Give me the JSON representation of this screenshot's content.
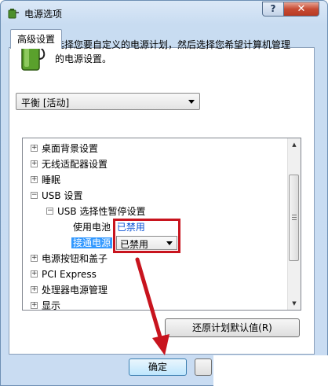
{
  "window": {
    "title": "电源选项",
    "help_label": "?",
    "close_label": "✕"
  },
  "tabs": [
    {
      "label": "高级设置"
    }
  ],
  "description": "选择您要自定义的电源计划，然后选择您希望计算机管理的电源设置。",
  "plan_select": {
    "value": "平衡 [活动]"
  },
  "tree": {
    "items": [
      {
        "label": "桌面背景设置",
        "expander": "+"
      },
      {
        "label": "无线适配器设置",
        "expander": "+"
      },
      {
        "label": "睡眠",
        "expander": "+"
      },
      {
        "label": "USB 设置",
        "expander": "−"
      },
      {
        "label": "USB 选择性暂停设置",
        "expander": "−"
      },
      {
        "label": "使用电池",
        "value": "已禁用"
      },
      {
        "label": "接通电源",
        "value": "已禁用"
      },
      {
        "label": "电源按钮和盖子",
        "expander": "+"
      },
      {
        "label": "PCI Express",
        "expander": "+"
      },
      {
        "label": "处理器电源管理",
        "expander": "+"
      },
      {
        "label": "显示",
        "expander": "+"
      }
    ]
  },
  "buttons": {
    "restore_defaults": "还原计划默认值(R)",
    "ok": "确定",
    "cancel": ""
  },
  "colors": {
    "highlight": "#3399ff",
    "annotation": "#c8141e",
    "link_value": "#0a52d6"
  },
  "icons": [
    "power-options-icon",
    "battery-plug-icon",
    "chevron-down-icon",
    "scroll-up-icon",
    "scroll-down-icon"
  ]
}
